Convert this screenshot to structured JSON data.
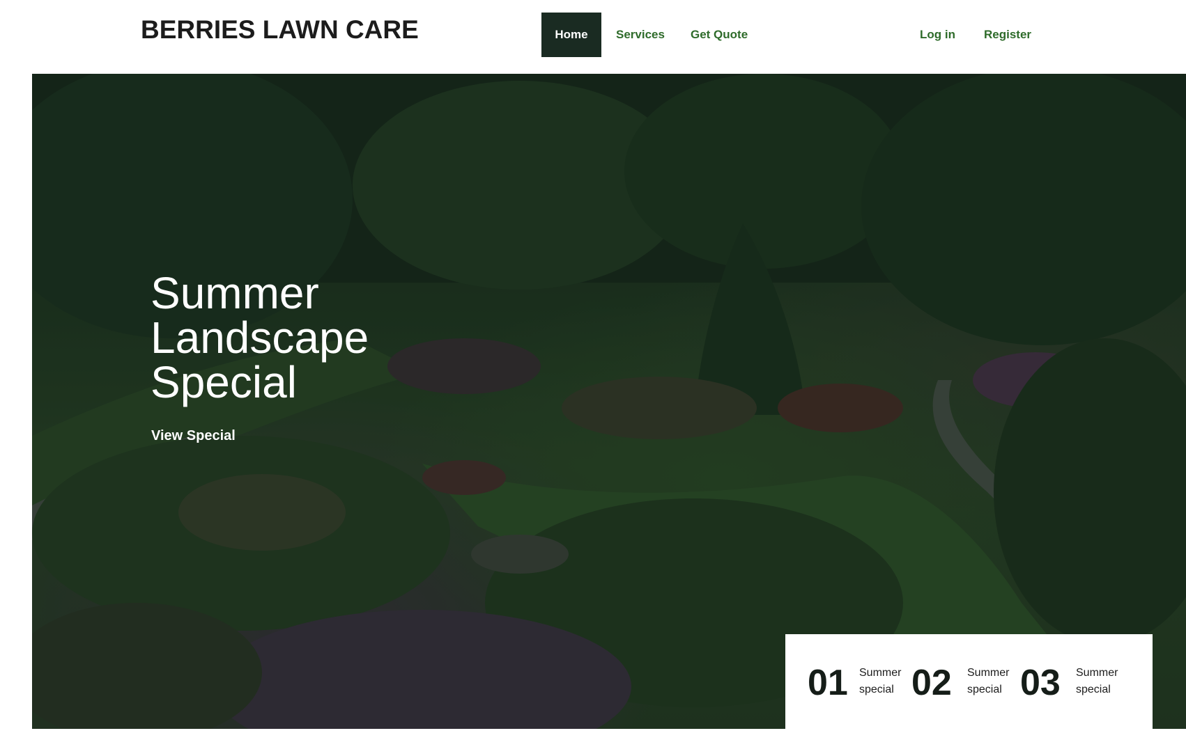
{
  "brand": "BERRIES LAWN CARE",
  "nav": {
    "home": "Home",
    "services": "Services",
    "quote": "Get Quote",
    "login": "Log in",
    "register": "Register"
  },
  "hero": {
    "title_lines": [
      "Summer",
      "Landscape",
      "Special"
    ],
    "cta": "View Special"
  },
  "specials": [
    {
      "number": "01",
      "label": "Summer special"
    },
    {
      "number": "02",
      "label": "Summer special"
    },
    {
      "number": "03",
      "label": "Summer special"
    }
  ],
  "colors": {
    "nav_active_bg": "#1a2b22",
    "nav_link": "#2e6b2a",
    "text_dark": "#1c1c1c",
    "hero_overlay": "#122318"
  }
}
